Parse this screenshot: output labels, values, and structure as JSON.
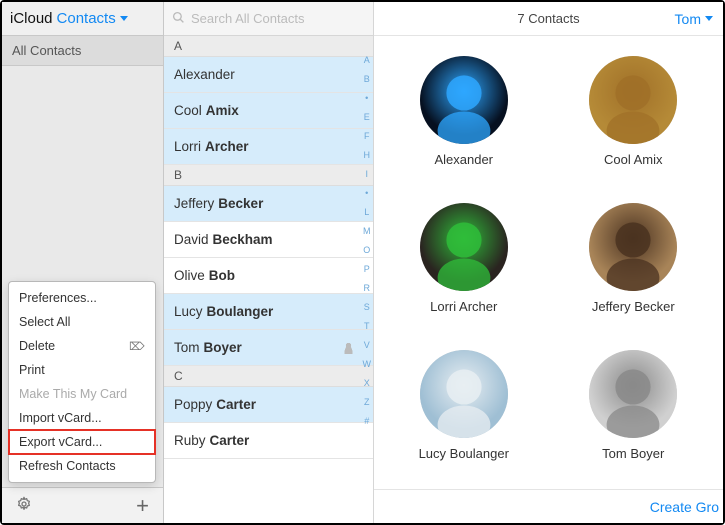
{
  "header": {
    "brand": "iCloud",
    "app_name": "Contacts"
  },
  "sidebar": {
    "group_label": "All Contacts"
  },
  "context_menu": {
    "items": [
      {
        "label": "Preferences...",
        "disabled": false
      },
      {
        "label": "Select All",
        "disabled": false
      },
      {
        "label": "Delete",
        "disabled": false,
        "icon": "delete"
      },
      {
        "label": "Print",
        "disabled": false
      },
      {
        "label": "Make This My Card",
        "disabled": true
      },
      {
        "label": "Import vCard...",
        "disabled": false
      },
      {
        "label": "Export vCard...",
        "disabled": false,
        "highlight": true
      },
      {
        "label": "Refresh Contacts",
        "disabled": false
      }
    ]
  },
  "search": {
    "placeholder": "Search All Contacts"
  },
  "index_letters": [
    "A",
    "B",
    "*",
    "E",
    "F",
    "H",
    "I",
    "*",
    "L",
    "M",
    "O",
    "P",
    "R",
    "S",
    "T",
    "V",
    "W",
    "X",
    "Z",
    "#"
  ],
  "sections": [
    {
      "letter": "A",
      "rows": [
        {
          "first": "Alexander",
          "last": "",
          "selected": true
        },
        {
          "first": "Cool",
          "last": "Amix",
          "selected": true
        },
        {
          "first": "Lorri",
          "last": "Archer",
          "selected": true
        }
      ]
    },
    {
      "letter": "B",
      "rows": [
        {
          "first": "Jeffery",
          "last": "Becker",
          "selected": true
        },
        {
          "first": "David",
          "last": "Beckham",
          "selected": false
        },
        {
          "first": "Olive",
          "last": "Bob",
          "selected": false
        },
        {
          "first": "Lucy",
          "last": "Boulanger",
          "selected": true
        },
        {
          "first": "Tom",
          "last": "Boyer",
          "selected": true,
          "me": true
        }
      ]
    },
    {
      "letter": "C",
      "rows": [
        {
          "first": "Poppy",
          "last": "Carter",
          "selected": true
        },
        {
          "first": "Ruby",
          "last": "Carter",
          "selected": false
        }
      ]
    }
  ],
  "detail": {
    "count_text": "7 Contacts",
    "user_name": "Tom",
    "create_group": "Create Gro",
    "cards": [
      {
        "name": "Alexander",
        "avatar": "xray"
      },
      {
        "name": "Cool Amix",
        "avatar": "llama"
      },
      {
        "name": "Lorri Archer",
        "avatar": "lantern"
      },
      {
        "name": "Jeffery Becker",
        "avatar": "cat"
      },
      {
        "name": "Lucy Boulanger",
        "avatar": "beluga"
      },
      {
        "name": "Tom Boyer",
        "avatar": "baby"
      }
    ]
  }
}
